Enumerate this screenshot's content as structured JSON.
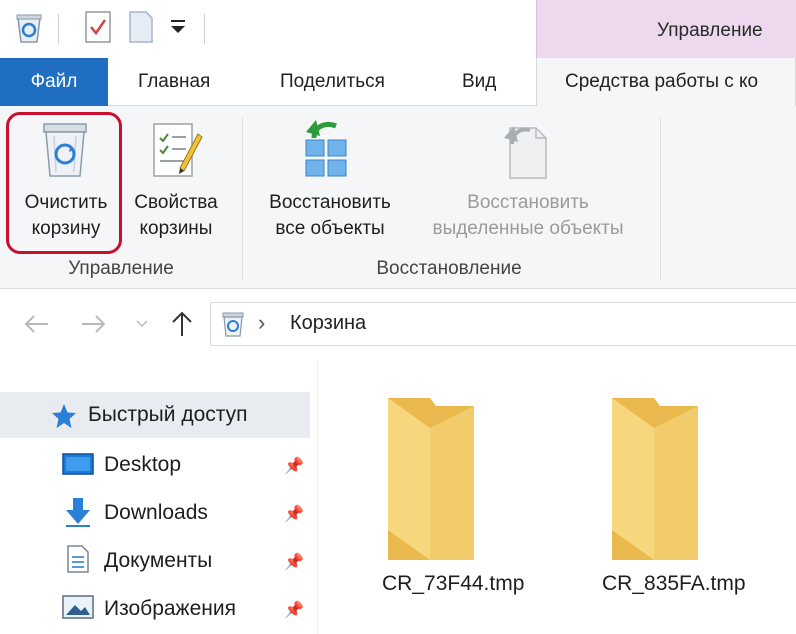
{
  "ribbon_context": {
    "title": "Управление",
    "tools_tab": "Средства работы с ко"
  },
  "tabs": {
    "file": "Файл",
    "home": "Главная",
    "share": "Поделиться",
    "view": "Вид"
  },
  "ribbon": {
    "empty_bin": [
      "Очистить",
      "корзину"
    ],
    "bin_properties": [
      "Свойства",
      "корзины"
    ],
    "restore_all": [
      "Восстановить",
      "все объекты"
    ],
    "restore_selected": [
      "Восстановить",
      "выделенные объекты"
    ],
    "group_manage": "Управление",
    "group_restore": "Восстановление"
  },
  "address": {
    "location": "Корзина",
    "chevron": "›"
  },
  "nav": {
    "quick_access": "Быстрый доступ",
    "items": [
      {
        "label": "Desktop",
        "icon": "desktop-icon"
      },
      {
        "label": "Downloads",
        "icon": "downloads-icon"
      },
      {
        "label": "Документы",
        "icon": "documents-icon"
      },
      {
        "label": "Изображения",
        "icon": "pictures-icon"
      }
    ]
  },
  "files": [
    {
      "name": "CR_73F44.tmp",
      "icon": "folder-icon"
    },
    {
      "name": "CR_835FA.tmp",
      "icon": "folder-icon"
    }
  ],
  "colors": {
    "file_tab": "#1f6ec2",
    "context_header": "#ecd9ee",
    "highlight": "#c8102e",
    "folder": "#f2cb6b"
  }
}
